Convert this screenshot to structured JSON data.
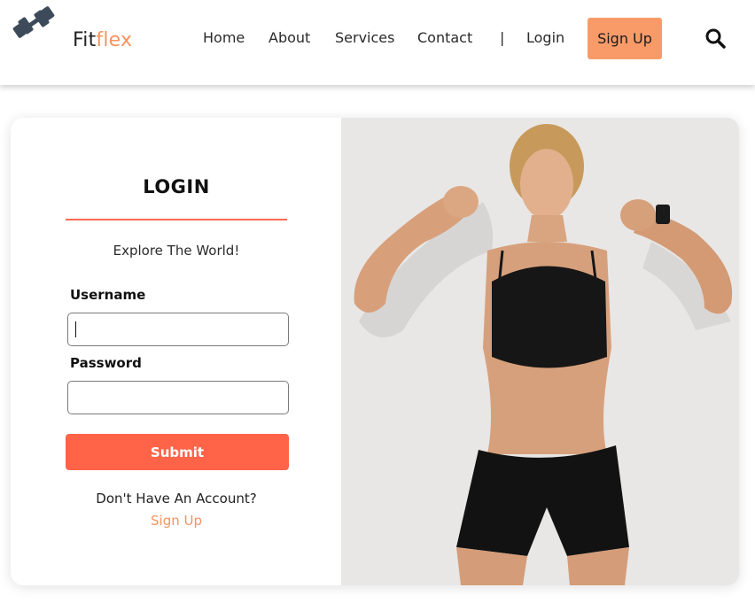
{
  "brand": {
    "part1": "Fit",
    "part2": "flex",
    "icon": "dumbbell-icon"
  },
  "nav": {
    "items": [
      "Home",
      "About",
      "Services",
      "Contact"
    ],
    "separator": "|",
    "login": "Login",
    "signup": "Sign Up",
    "search_icon": "search-icon"
  },
  "form": {
    "title": "LOGIN",
    "tagline": "Explore The World!",
    "username_label": "Username",
    "username_value": "",
    "password_label": "Password",
    "password_value": "",
    "submit": "Submit",
    "no_account": "Don't Have An Account?",
    "signup_link": "Sign Up"
  },
  "colors": {
    "accent_orange": "#f7935f",
    "signup_button": "#f99b69",
    "submit_button": "#ff6449",
    "rule": "#ff6a4f"
  }
}
